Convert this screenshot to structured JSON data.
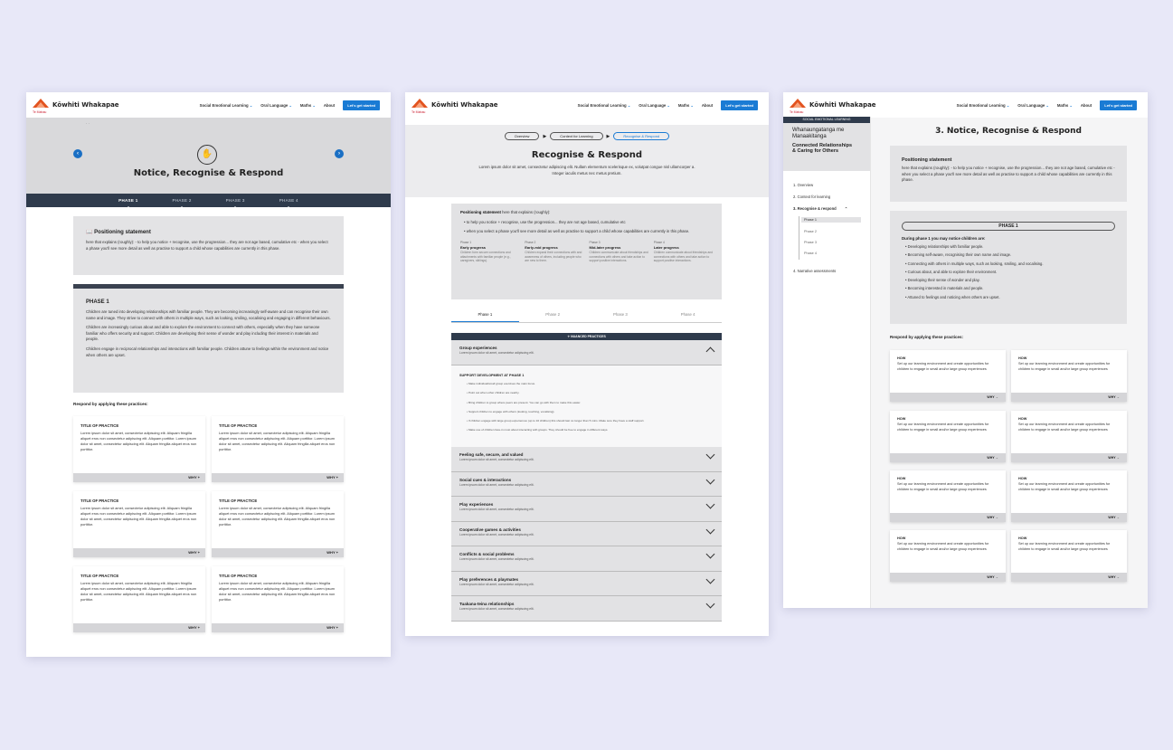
{
  "nav": {
    "brand": "Kōwhiti Whakapae",
    "logo_sub": "Te Mahau",
    "items": [
      "Social Emotional Learning",
      "Oral Language",
      "Maths"
    ],
    "about": "About",
    "cta": "Let's get started"
  },
  "board1": {
    "crumbs": "·                  ·",
    "title": "Notice, Recognise & Respond",
    "tabs": [
      "PHASE 1",
      "PHASE 2",
      "PHASE 3",
      "PHASE 4"
    ],
    "positioning_title": "Positioning statement",
    "positioning_text": "here that explains (roughly): - to help you notice + recognise, use the progression... they are not age based, cumulative etc - when you select a phase you'll see more detail as well as practise to support a child whose capabilities are currently in this phase.",
    "phase_title": "PHASE 1",
    "phase_paras": [
      "Children are tuned into developing relationships with familiar people. They are becoming increasingly self-aware and can recognise their own name and image. They strive to connect with others in multiple ways, such as looking, smiling, vocalising and engaging in different behaviours.",
      "Children are increasingly curious about and able to explore the environment to connect with others, especially when they have someone familiar who offers security and support. Children are developing their sense of wonder and play including their interest in materials and people.",
      "Children engage in reciprocal relationships and interactions with familiar people. Children attune to feelings within the environment and notice when others are upset."
    ],
    "respond": "Respond by applying these practices:",
    "card_title": "TITLE OF PRACTICE",
    "card_text": "Lorem ipsum dolor sit amet, consectetur adipiscing elit. Aliquam fringilla aliquet eros non consectetur adipiscing elit. Aliquam porttitor. Lorem ipsum dolor sit amet, consectetur adipiscing elit. Aliquam fringilla aliquet eros non porttitor.",
    "why": "WHY +"
  },
  "board2": {
    "steps": [
      "Overview",
      "Context for Learning",
      "Recognise & Respond"
    ],
    "title": "Recognise & Respond",
    "intro": "Lorem ipsum dolor sit amet, consectetur adipiscing elit. Nullam elementum scelerisque ex, volutpat congue nisl ullamcorper a. Integer iaculis metus nec metus pretium.",
    "pos_label": "Positioning statement",
    "pos_rest": "here that explains (roughly):",
    "bullets": [
      "to help you notice + recognise, use the progression... they are not age based, cumulative etc",
      "when you select a phase you'll see more detail as well as practise to support a child whose capabilities are currently in this phase."
    ],
    "progress": [
      {
        "ph": "Phase 1",
        "t": "Early progress",
        "d": "Children form secure connections and attachments with familiar people (e.g., caregivers, siblings)."
      },
      {
        "ph": "Phase 2",
        "t": "Early-mid progress",
        "d": "Children expand their connections with and awareness of others, including people who are new to them."
      },
      {
        "ph": "Phase 3",
        "t": "Mid-later progress",
        "d": "Children communicate about friendships and connections with others and take action to support positive interactions."
      },
      {
        "ph": "Phase 4",
        "t": "Later progress",
        "d": "Children communicate about friendships and connections with others and take action to support positive interactions."
      }
    ],
    "tabs": [
      "Phase 1",
      "Phase 2",
      "Phase 3",
      "Phase 4"
    ],
    "bar": "NUANCED PRACTICES",
    "open_title": "Group experiences",
    "sub": "Lorem ipsum dolor sit amet, consectetur adipiscing elit.",
    "support": "SUPPORT DEVELOPMENT AT PHASE 1",
    "support_items": [
      "Make individual/small group exercises the main focus.",
      "Point out when other children are nearby.",
      "Bring children to group where peers are present. You can go with them to make this easier.",
      "Support children to engage with others (looking, touching, vocalising).",
      "If children engage with large group experiences (up to 10 children) this should last no longer than 5 mins. Make sure they have a staff support.",
      "Make use of children face-in most about interacting with groups. They should be free to engage in different ways."
    ],
    "rows": [
      "Feeling safe, secure, and valued",
      "Social cues & interactions",
      "Play experiences",
      "Cooperative games & activities",
      "Conflicts & social problems",
      "Play preferences & playmates",
      "Tuakana-teina relationships"
    ]
  },
  "board3": {
    "side_head": "SOCIAL EMOTIONAL LEARNING",
    "side_maori": "Whanaungatanga me Manaakitanga",
    "side_title": "Connected Relationships & Caring for Others",
    "nav": [
      "1. Overview",
      "2. Context for learning",
      "3. Recognise & respond",
      "4. Narrative assessments"
    ],
    "phases": [
      "Phase 1",
      "Phase 2",
      "Phase 3",
      "Phase 4"
    ],
    "title": "3. Notice, Recognise & Respond",
    "pos_title": "Positioning statement",
    "pos_text": "here that explains (roughly): - to help you notice + recognise, use the progression... they are not age based, cumulative etc - when you select a phase you'll see more detail as well as practise to support a child whose capabilities are currently in this phase.",
    "phase_pill": "PHASE 1",
    "during": "During phase 1 you may notice children are:",
    "notices": [
      "Developing relationships with familiar people.",
      "Becoming self-aware, recognising their own name and image.",
      "Connecting with others in multiple ways, such as looking, smiling, and vocalising.",
      "Curious about, and able to explore their environment.",
      "Developing their sense of wonder and play.",
      "Becoming interested in materials and people.",
      "Attuned to feelings and noticing when others are upset."
    ],
    "respond": "Respond by applying these practices:",
    "how": "HOW",
    "how_text": "Set up our learning environment and create opportunities for children to engage in small and/or large group experiences",
    "why": "WHY →"
  }
}
